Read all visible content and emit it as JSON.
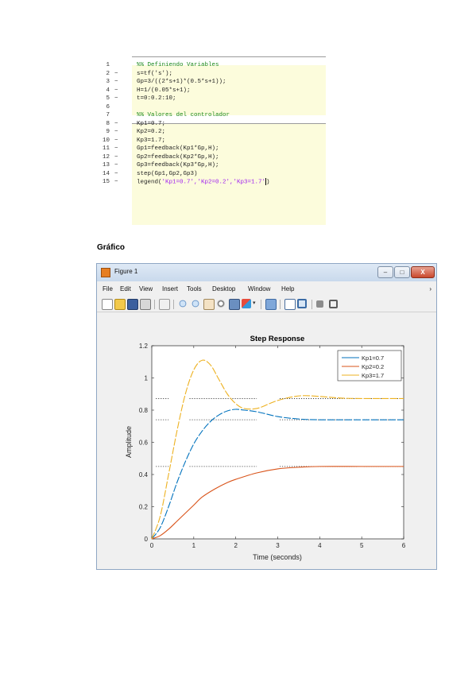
{
  "code": {
    "lines": [
      {
        "num": "1",
        "dash": "",
        "text": "%% Definiendo Variables",
        "comment": true
      },
      {
        "num": "2",
        "dash": "−",
        "text": "s=tf('s');"
      },
      {
        "num": "3",
        "dash": "−",
        "text": "Gp=3/((2*s+1)*(0.5*s+1));"
      },
      {
        "num": "4",
        "dash": "−",
        "text": "H=1/(0.05*s+1);"
      },
      {
        "num": "5",
        "dash": "−",
        "text": "t=0:0.2:10;"
      },
      {
        "num": "6",
        "dash": "",
        "text": ""
      },
      {
        "num": "7",
        "dash": "",
        "text": "%% Valores del controlador",
        "comment": true
      },
      {
        "num": "8",
        "dash": "−",
        "text": "Kp1=0.7;"
      },
      {
        "num": "9",
        "dash": "−",
        "text": "Kp2=0.2;"
      },
      {
        "num": "10",
        "dash": "−",
        "text": "Kp3=1.7;"
      },
      {
        "num": "11",
        "dash": "−",
        "text": "Gp1=feedback(Kp1*Gp,H);"
      },
      {
        "num": "12",
        "dash": "−",
        "text": "Gp2=feedback(Kp2*Gp,H);"
      },
      {
        "num": "13",
        "dash": "−",
        "text": "Gp3=feedback(Kp3*Gp,H);"
      },
      {
        "num": "14",
        "dash": "−",
        "text": "step(Gp1,Gp2,Gp3)"
      },
      {
        "num": "15",
        "dash": "−",
        "text": "legend(",
        "str": "'Kp1=0.7','Kp2=0.2','Kp3=1.7'",
        "end": ")"
      }
    ]
  },
  "section_label": "Gráfico",
  "window": {
    "title": "Figure 1",
    "minimize": "–",
    "maximize": "□",
    "close": "X",
    "menu": [
      "File",
      "Edit",
      "View",
      "Insert",
      "Tools",
      "Desktop",
      "Window",
      "Help"
    ],
    "menu_arrow": "›"
  },
  "colors": {
    "s1": "#0072bd",
    "s2": "#d95319",
    "s3": "#edb120"
  },
  "chart_data": {
    "type": "line",
    "title": "Step Response",
    "xlabel": "Time (seconds)",
    "ylabel": "Amplitude",
    "xlim": [
      0,
      6
    ],
    "ylim": [
      0,
      1.2
    ],
    "xticks": [
      "0",
      "1",
      "2",
      "3",
      "4",
      "5",
      "6"
    ],
    "yticks": [
      "0",
      "0.2",
      "0.4",
      "0.6",
      "0.8",
      "1",
      "1.2"
    ],
    "legend_position": "top-right",
    "series": [
      {
        "name": "Kp1=0.7",
        "x": [
          0,
          0.2,
          0.4,
          0.6,
          0.8,
          1.0,
          1.2,
          1.4,
          1.6,
          1.8,
          2.0,
          2.2,
          2.5,
          3.0,
          3.5,
          4.0,
          5.0,
          6.0
        ],
        "values": [
          0,
          0.07,
          0.2,
          0.35,
          0.48,
          0.59,
          0.67,
          0.73,
          0.77,
          0.795,
          0.805,
          0.8,
          0.79,
          0.76,
          0.745,
          0.74,
          0.74,
          0.74
        ]
      },
      {
        "name": "Kp2=0.2",
        "x": [
          0,
          0.2,
          0.4,
          0.6,
          0.8,
          1.0,
          1.2,
          1.5,
          1.8,
          2.0,
          2.5,
          3.0,
          3.5,
          4.0,
          5.0,
          6.0
        ],
        "values": [
          0,
          0.02,
          0.06,
          0.11,
          0.16,
          0.21,
          0.26,
          0.31,
          0.35,
          0.37,
          0.41,
          0.435,
          0.445,
          0.45,
          0.45,
          0.45
        ]
      },
      {
        "name": "Kp3=1.7",
        "x": [
          0,
          0.2,
          0.4,
          0.6,
          0.8,
          1.0,
          1.2,
          1.4,
          1.6,
          1.8,
          2.0,
          2.2,
          2.5,
          2.8,
          3.0,
          3.3,
          3.6,
          4.0,
          4.5,
          5.0,
          6.0
        ],
        "values": [
          0,
          0.14,
          0.4,
          0.67,
          0.9,
          1.05,
          1.11,
          1.08,
          0.99,
          0.9,
          0.84,
          0.81,
          0.81,
          0.84,
          0.86,
          0.88,
          0.89,
          0.885,
          0.875,
          0.872,
          0.872
        ]
      }
    ],
    "steady_state": [
      0.74,
      0.45,
      0.872
    ]
  }
}
